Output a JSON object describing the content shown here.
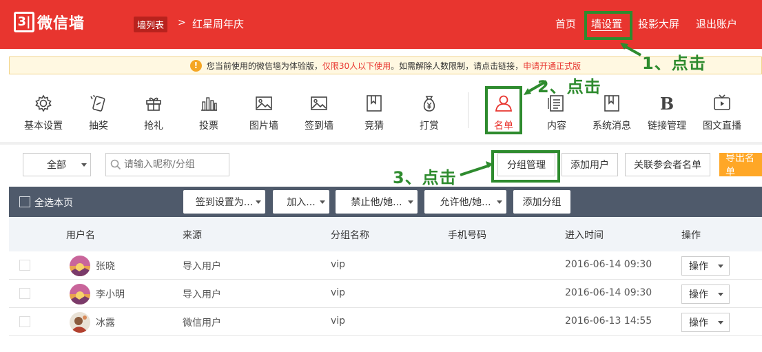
{
  "header": {
    "logo_mark": "3|",
    "logo_text": "微信墙",
    "breadcrumb_tag": "墙列表",
    "breadcrumb_sep": ">",
    "breadcrumb_current": "红星周年庆",
    "nav": [
      "首页",
      "墙设置",
      "投影大屏",
      "退出账户"
    ],
    "active_nav": "墙设置"
  },
  "notice": {
    "icon": "warning-icon",
    "text_a": "您当前使用的微信墙为体验版，",
    "text_limit": "仅限30人以下使用",
    "text_b": "。如需解除人数限制，请点击链接，",
    "link": "申请开通正式版"
  },
  "toolbar": {
    "items": [
      {
        "label": "基本设置",
        "icon": "gear-icon"
      },
      {
        "label": "抽奖",
        "icon": "lottery-icon"
      },
      {
        "label": "抢礼",
        "icon": "gift-icon"
      },
      {
        "label": "投票",
        "icon": "bar-chart-icon"
      },
      {
        "label": "图片墙",
        "icon": "image-icon"
      },
      {
        "label": "签到墙",
        "icon": "image-icon"
      },
      {
        "label": "竞猜",
        "icon": "bookmark-icon"
      },
      {
        "label": "打赏",
        "icon": "money-bag-icon"
      },
      {
        "label": "名单",
        "icon": "user-icon"
      },
      {
        "label": "内容",
        "icon": "document-icon"
      },
      {
        "label": "系统消息",
        "icon": "bookmark-icon"
      },
      {
        "label": "链接管理",
        "icon": "bold-b-icon"
      },
      {
        "label": "图文直播",
        "icon": "tv-icon"
      }
    ],
    "active": "名单"
  },
  "filters": {
    "group_select": "全部",
    "search_placeholder": "请输入昵称/分组",
    "buttons": [
      "分组管理",
      "添加用户",
      "关联参会者名单",
      "导出名单"
    ]
  },
  "bulk_bar": {
    "select_all": "全选本页",
    "dropdowns": [
      "签到设置为...",
      "加入...",
      "禁止他/她...",
      "允许他/她..."
    ],
    "add_group": "添加分组"
  },
  "table": {
    "columns": [
      "用户名",
      "来源",
      "分组名称",
      "手机号码",
      "进入时间",
      "操作"
    ],
    "rows": [
      {
        "name": "张晓",
        "source": "导入用户",
        "group": "vip",
        "phone": "",
        "time": "2016-06-14 09:30",
        "action": "操作"
      },
      {
        "name": "李小明",
        "source": "导入用户",
        "group": "vip",
        "phone": "",
        "time": "2016-06-14 09:30",
        "action": "操作"
      },
      {
        "name": "冰露",
        "source": "微信用户",
        "group": "vip",
        "phone": "",
        "time": "2016-06-13 14:55",
        "action": "操作"
      }
    ]
  },
  "annotations": [
    "1、点击",
    "2、点击",
    "3、点击"
  ],
  "colors": {
    "brand_red": "#e8352f",
    "annotation_green": "#2e8b2e",
    "dark_bar": "#4f5a6b",
    "orange": "#ffa726"
  }
}
